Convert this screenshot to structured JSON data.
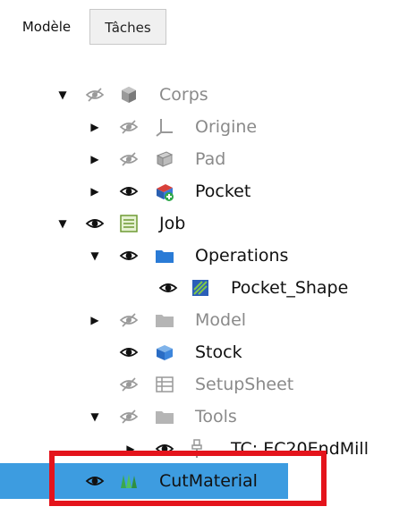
{
  "tabs": [
    {
      "label": "Modèle",
      "active": true
    },
    {
      "label": "Tâches",
      "active": false
    }
  ],
  "colors": {
    "selection": "#3d9ce0",
    "highlight_box": "#e4141c",
    "folder": "#2a7bd6",
    "dim_text": "#8a8a8a"
  },
  "tree": [
    {
      "label": "Corps",
      "expand": "expanded",
      "visible": false,
      "icon": "body-icon"
    },
    {
      "label": "Origine",
      "expand": "collapsed",
      "visible": false,
      "icon": "origin-icon"
    },
    {
      "label": "Pad",
      "expand": "collapsed",
      "visible": false,
      "icon": "pad-icon"
    },
    {
      "label": "Pocket",
      "expand": "collapsed",
      "visible": true,
      "icon": "pocket-icon"
    },
    {
      "label": "Job",
      "expand": "expanded",
      "visible": true,
      "icon": "job-icon"
    },
    {
      "label": "Operations",
      "expand": "expanded",
      "visible": true,
      "icon": "folder-icon"
    },
    {
      "label": "Pocket_Shape",
      "expand": "none",
      "visible": true,
      "icon": "pocket-shape-icon"
    },
    {
      "label": "Model",
      "expand": "collapsed",
      "visible": false,
      "icon": "folder-icon"
    },
    {
      "label": "Stock",
      "expand": "none",
      "visible": true,
      "icon": "stock-icon"
    },
    {
      "label": "SetupSheet",
      "expand": "none",
      "visible": false,
      "icon": "setupsheet-icon"
    },
    {
      "label": "Tools",
      "expand": "expanded",
      "visible": false,
      "icon": "folder-icon"
    },
    {
      "label": "TC: EC20EndMill",
      "expand": "collapsed",
      "visible": true,
      "icon": "toolcontroller-icon"
    },
    {
      "label": "CutMaterial",
      "expand": "none",
      "visible": true,
      "icon": "cutmaterial-icon",
      "selected": true
    }
  ]
}
